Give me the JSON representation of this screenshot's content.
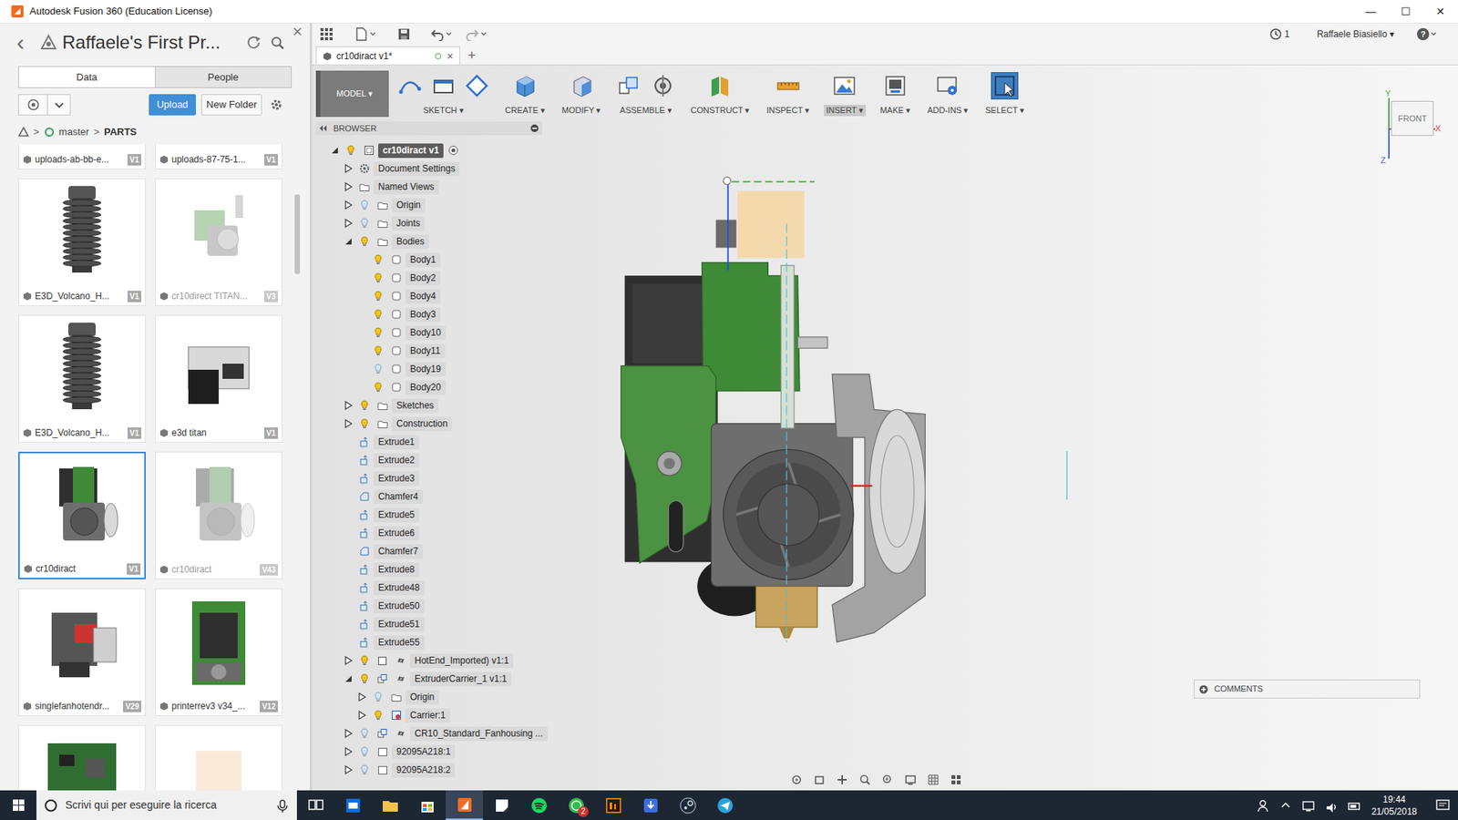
{
  "window": {
    "title": "Autodesk Fusion 360 (Education License)",
    "controls": [
      "—",
      "☐",
      "✕"
    ]
  },
  "data_panel": {
    "back": "‹",
    "project": "Raffaele's First Pr...",
    "close": "×",
    "tabs": [
      {
        "label": "Data",
        "selected": true
      },
      {
        "label": "People",
        "selected": false
      }
    ],
    "upload": "Upload",
    "new_folder": "New Folder",
    "breadcrumb": {
      "branch": "master",
      "separator": ">",
      "folder": "PARTS"
    },
    "files": [
      {
        "name": "uploads-ab-bb-e...",
        "version": "V1",
        "kind": "cut",
        "greyed": false,
        "selected": false
      },
      {
        "name": "uploads-87-75-1...",
        "version": "V1",
        "kind": "cut",
        "greyed": false,
        "selected": false
      },
      {
        "name": "E3D_Volcano_H...",
        "version": "V1",
        "kind": "heatsink",
        "greyed": false,
        "selected": false
      },
      {
        "name": "cr10direct TITAN...",
        "version": "V3",
        "kind": "assembly-small",
        "greyed": true,
        "selected": false
      },
      {
        "name": "E3D_Volcano_H...",
        "version": "V1",
        "kind": "heatsink",
        "greyed": false,
        "selected": false
      },
      {
        "name": "e3d titan",
        "version": "V1",
        "kind": "extruder",
        "greyed": false,
        "selected": false
      },
      {
        "name": "cr10diract",
        "version": "V1",
        "kind": "assembly",
        "greyed": false,
        "selected": true
      },
      {
        "name": "cr10diract",
        "version": "V43",
        "kind": "assembly",
        "greyed": true,
        "selected": false
      },
      {
        "name": "singlefanhotendr...",
        "version": "V29",
        "kind": "hotend",
        "greyed": false,
        "selected": false
      },
      {
        "name": "printerrev3 v34_...",
        "version": "V12",
        "kind": "printer",
        "greyed": false,
        "selected": false
      }
    ],
    "partial_files": [
      {
        "kind": "board"
      },
      {
        "kind": "blank"
      }
    ]
  },
  "quick_bar": {
    "jobs": "1",
    "user": "Raffaele Biasiello ▾",
    "help": "?"
  },
  "document_tab": {
    "label": "cr10diract v1*",
    "close": "×",
    "add": "+"
  },
  "toolbar": {
    "workspace": "MODEL ▾",
    "groups": [
      {
        "label": "SKETCH ▾",
        "icons": [
          "sketch-line",
          "sketch-rect",
          "sketch-plane"
        ],
        "selected": false,
        "hovered": false
      },
      {
        "label": "CREATE ▾",
        "icons": [
          "create-box"
        ],
        "selected": false,
        "hovered": false
      },
      {
        "label": "MODIFY ▾",
        "icons": [
          "modify"
        ],
        "selected": false,
        "hovered": false
      },
      {
        "label": "ASSEMBLE ▾",
        "icons": [
          "new-component",
          "joint"
        ],
        "selected": false,
        "hovered": false
      },
      {
        "label": "CONSTRUCT ▾",
        "icons": [
          "construct"
        ],
        "selected": false,
        "hovered": false
      },
      {
        "label": "INSPECT ▾",
        "icons": [
          "measure"
        ],
        "selected": false,
        "hovered": false
      },
      {
        "label": "INSERT ▾",
        "icons": [
          "image"
        ],
        "selected": true,
        "hovered": false
      },
      {
        "label": "MAKE ▾",
        "icons": [
          "print"
        ],
        "selected": false,
        "hovered": false
      },
      {
        "label": "ADD-INS ▾",
        "icons": [
          "addins"
        ],
        "selected": false,
        "hovered": false
      },
      {
        "label": "SELECT ▾",
        "icons": [
          "select"
        ],
        "selected": false,
        "hovered": true
      }
    ]
  },
  "browser": {
    "title": "BROWSER",
    "items": [
      {
        "label": "cr10diract v1",
        "level": 0,
        "toggle": "expanded",
        "bulb": "on",
        "kind": "component",
        "selected": true
      },
      {
        "label": "Document Settings",
        "level": 1,
        "toggle": "collapsed",
        "bulb": "none",
        "kind": "settings",
        "selected": false
      },
      {
        "label": "Named Views",
        "level": 1,
        "toggle": "collapsed",
        "bulb": "none",
        "kind": "folder",
        "selected": false
      },
      {
        "label": "Origin",
        "level": 1,
        "toggle": "collapsed",
        "bulb": "off",
        "kind": "folder",
        "selected": false
      },
      {
        "label": "Joints",
        "level": 1,
        "toggle": "collapsed",
        "bulb": "off",
        "kind": "folder",
        "selected": false
      },
      {
        "label": "Bodies",
        "level": 1,
        "toggle": "expanded",
        "bulb": "on",
        "kind": "folder",
        "selected": false
      },
      {
        "label": "Body1",
        "level": 2,
        "toggle": "none",
        "bulb": "on",
        "kind": "body",
        "selected": false
      },
      {
        "label": "Body2",
        "level": 2,
        "toggle": "none",
        "bulb": "on",
        "kind": "body",
        "selected": false
      },
      {
        "label": "Body4",
        "level": 2,
        "toggle": "none",
        "bulb": "on",
        "kind": "body",
        "selected": false
      },
      {
        "label": "Body3",
        "level": 2,
        "toggle": "none",
        "bulb": "on",
        "kind": "body",
        "selected": false
      },
      {
        "label": "Body10",
        "level": 2,
        "toggle": "none",
        "bulb": "on",
        "kind": "body",
        "selected": false
      },
      {
        "label": "Body11",
        "level": 2,
        "toggle": "none",
        "bulb": "on",
        "kind": "body",
        "selected": false
      },
      {
        "label": "Body19",
        "level": 2,
        "toggle": "none",
        "bulb": "off",
        "kind": "body",
        "selected": false
      },
      {
        "label": "Body20",
        "level": 2,
        "toggle": "none",
        "bulb": "on",
        "kind": "body",
        "selected": false
      },
      {
        "label": "Sketches",
        "level": 1,
        "toggle": "collapsed",
        "bulb": "on",
        "kind": "folder",
        "selected": false
      },
      {
        "label": "Construction",
        "level": 1,
        "toggle": "collapsed",
        "bulb": "on",
        "kind": "folder",
        "selected": false
      },
      {
        "label": "Extrude1",
        "level": 1,
        "toggle": "none",
        "bulb": "none",
        "kind": "extrude",
        "selected": false
      },
      {
        "label": "Extrude2",
        "level": 1,
        "toggle": "none",
        "bulb": "none",
        "kind": "extrude",
        "selected": false
      },
      {
        "label": "Extrude3",
        "level": 1,
        "toggle": "none",
        "bulb": "none",
        "kind": "extrude",
        "selected": false
      },
      {
        "label": "Chamfer4",
        "level": 1,
        "toggle": "none",
        "bulb": "none",
        "kind": "chamfer",
        "selected": false
      },
      {
        "label": "Extrude5",
        "level": 1,
        "toggle": "none",
        "bulb": "none",
        "kind": "extrude",
        "selected": false
      },
      {
        "label": "Extrude6",
        "level": 1,
        "toggle": "none",
        "bulb": "none",
        "kind": "extrude",
        "selected": false
      },
      {
        "label": "Chamfer7",
        "level": 1,
        "toggle": "none",
        "bulb": "none",
        "kind": "chamfer",
        "selected": false
      },
      {
        "label": "Extrude8",
        "level": 1,
        "toggle": "none",
        "bulb": "none",
        "kind": "extrude",
        "selected": false
      },
      {
        "label": "Extrude48",
        "level": 1,
        "toggle": "none",
        "bulb": "none",
        "kind": "extrude",
        "selected": false
      },
      {
        "label": "Extrude50",
        "level": 1,
        "toggle": "none",
        "bulb": "none",
        "kind": "extrude",
        "selected": false
      },
      {
        "label": "Extrude51",
        "level": 1,
        "toggle": "none",
        "bulb": "none",
        "kind": "extrude",
        "selected": false
      },
      {
        "label": "Extrude55",
        "level": 1,
        "toggle": "none",
        "bulb": "none",
        "kind": "extrude",
        "selected": false
      },
      {
        "label": "HotEnd_Imported) v1:1",
        "level": 1,
        "toggle": "collapsed",
        "bulb": "on",
        "kind": "linked-component",
        "selected": false
      },
      {
        "label": "ExtruderCarrier_1 v1:1",
        "level": 1,
        "toggle": "expanded",
        "bulb": "on",
        "kind": "linked-assembly",
        "selected": false
      },
      {
        "label": "Origin",
        "level": 2,
        "toggle": "collapsed",
        "bulb": "off",
        "kind": "folder",
        "selected": false
      },
      {
        "label": "Carrier:1",
        "level": 2,
        "toggle": "collapsed",
        "bulb": "on",
        "kind": "active-component",
        "selected": false
      },
      {
        "label": "CR10_Standard_Fanhousing ...",
        "level": 1,
        "toggle": "collapsed",
        "bulb": "off",
        "kind": "linked-assembly",
        "selected": false
      },
      {
        "label": "92095A218:1",
        "level": 1,
        "toggle": "collapsed",
        "bulb": "off",
        "kind": "part",
        "selected": false
      },
      {
        "label": "92095A218:2",
        "level": 1,
        "toggle": "collapsed",
        "bulb": "off",
        "kind": "part",
        "selected": false
      }
    ]
  },
  "view_cube": {
    "face": "FRONT",
    "axes": [
      "Y",
      "X",
      "Z"
    ]
  },
  "comments": {
    "label": "COMMENTS"
  },
  "taskbar": {
    "search_placeholder": "Scrivi qui per eseguire la ricerca",
    "apps": [
      {
        "kind": "taskview",
        "active": false,
        "badge": ""
      },
      {
        "kind": "edge",
        "active": false,
        "badge": ""
      },
      {
        "kind": "explorer",
        "active": false,
        "badge": ""
      },
      {
        "kind": "store",
        "active": false,
        "badge": ""
      },
      {
        "kind": "fusion",
        "active": true,
        "badge": ""
      },
      {
        "kind": "sticky",
        "active": false,
        "badge": ""
      },
      {
        "kind": "spotify",
        "active": false,
        "badge": ""
      },
      {
        "kind": "whatsapp",
        "active": false,
        "badge": "2"
      },
      {
        "kind": "illustrator",
        "active": false,
        "badge": ""
      },
      {
        "kind": "download",
        "active": false,
        "badge": ""
      },
      {
        "kind": "steam",
        "active": false,
        "badge": ""
      },
      {
        "kind": "telegram",
        "active": false,
        "badge": ""
      }
    ],
    "time": "19:44",
    "date": "21/05/2018"
  }
}
